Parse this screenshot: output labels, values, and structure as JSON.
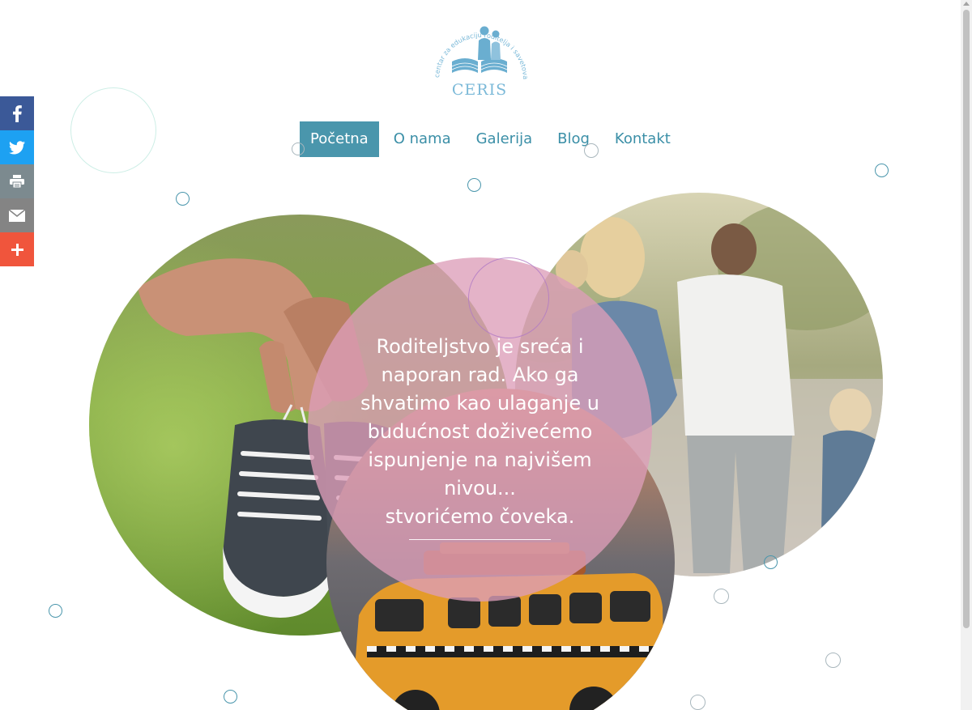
{
  "share_bar": {
    "items": [
      {
        "name": "facebook",
        "glyph": "f",
        "color": "#3b5998"
      },
      {
        "name": "twitter",
        "glyph": "twitter-bird",
        "color": "#1da1f2"
      },
      {
        "name": "print",
        "glyph": "printer",
        "color": "#7c8a8f"
      },
      {
        "name": "email",
        "glyph": "envelope",
        "color": "#848484"
      },
      {
        "name": "more",
        "glyph": "+",
        "color": "#f0553c"
      }
    ]
  },
  "logo": {
    "name": "CERIS",
    "arc_text": "centar za edukaciju roditelja i savetovanje",
    "color": "#7bb9d8"
  },
  "nav": {
    "items": [
      {
        "label": "Početna",
        "active": true
      },
      {
        "label": "O nama",
        "active": false
      },
      {
        "label": "Galerija",
        "active": false
      },
      {
        "label": "Blog",
        "active": false
      },
      {
        "label": "Kontakt",
        "active": false
      }
    ],
    "active_color": "#4a96ac",
    "text_color": "#3b8fa7"
  },
  "hero": {
    "quote_lines": [
      "Roditeljstvo je sreća i",
      "naporan rad. Ako ga",
      "shvatimo kao ulaganje u",
      "budućnost doživećemo",
      "ispunjenje na najvišem",
      "nivou...",
      "stvorićemo čoveka."
    ],
    "quote_circle_color": "#dd9eb9",
    "images": [
      {
        "subject": "hands holding baby sneakers"
      },
      {
        "subject": "family walking hand in hand"
      },
      {
        "subject": "toy yellow bus"
      }
    ]
  }
}
